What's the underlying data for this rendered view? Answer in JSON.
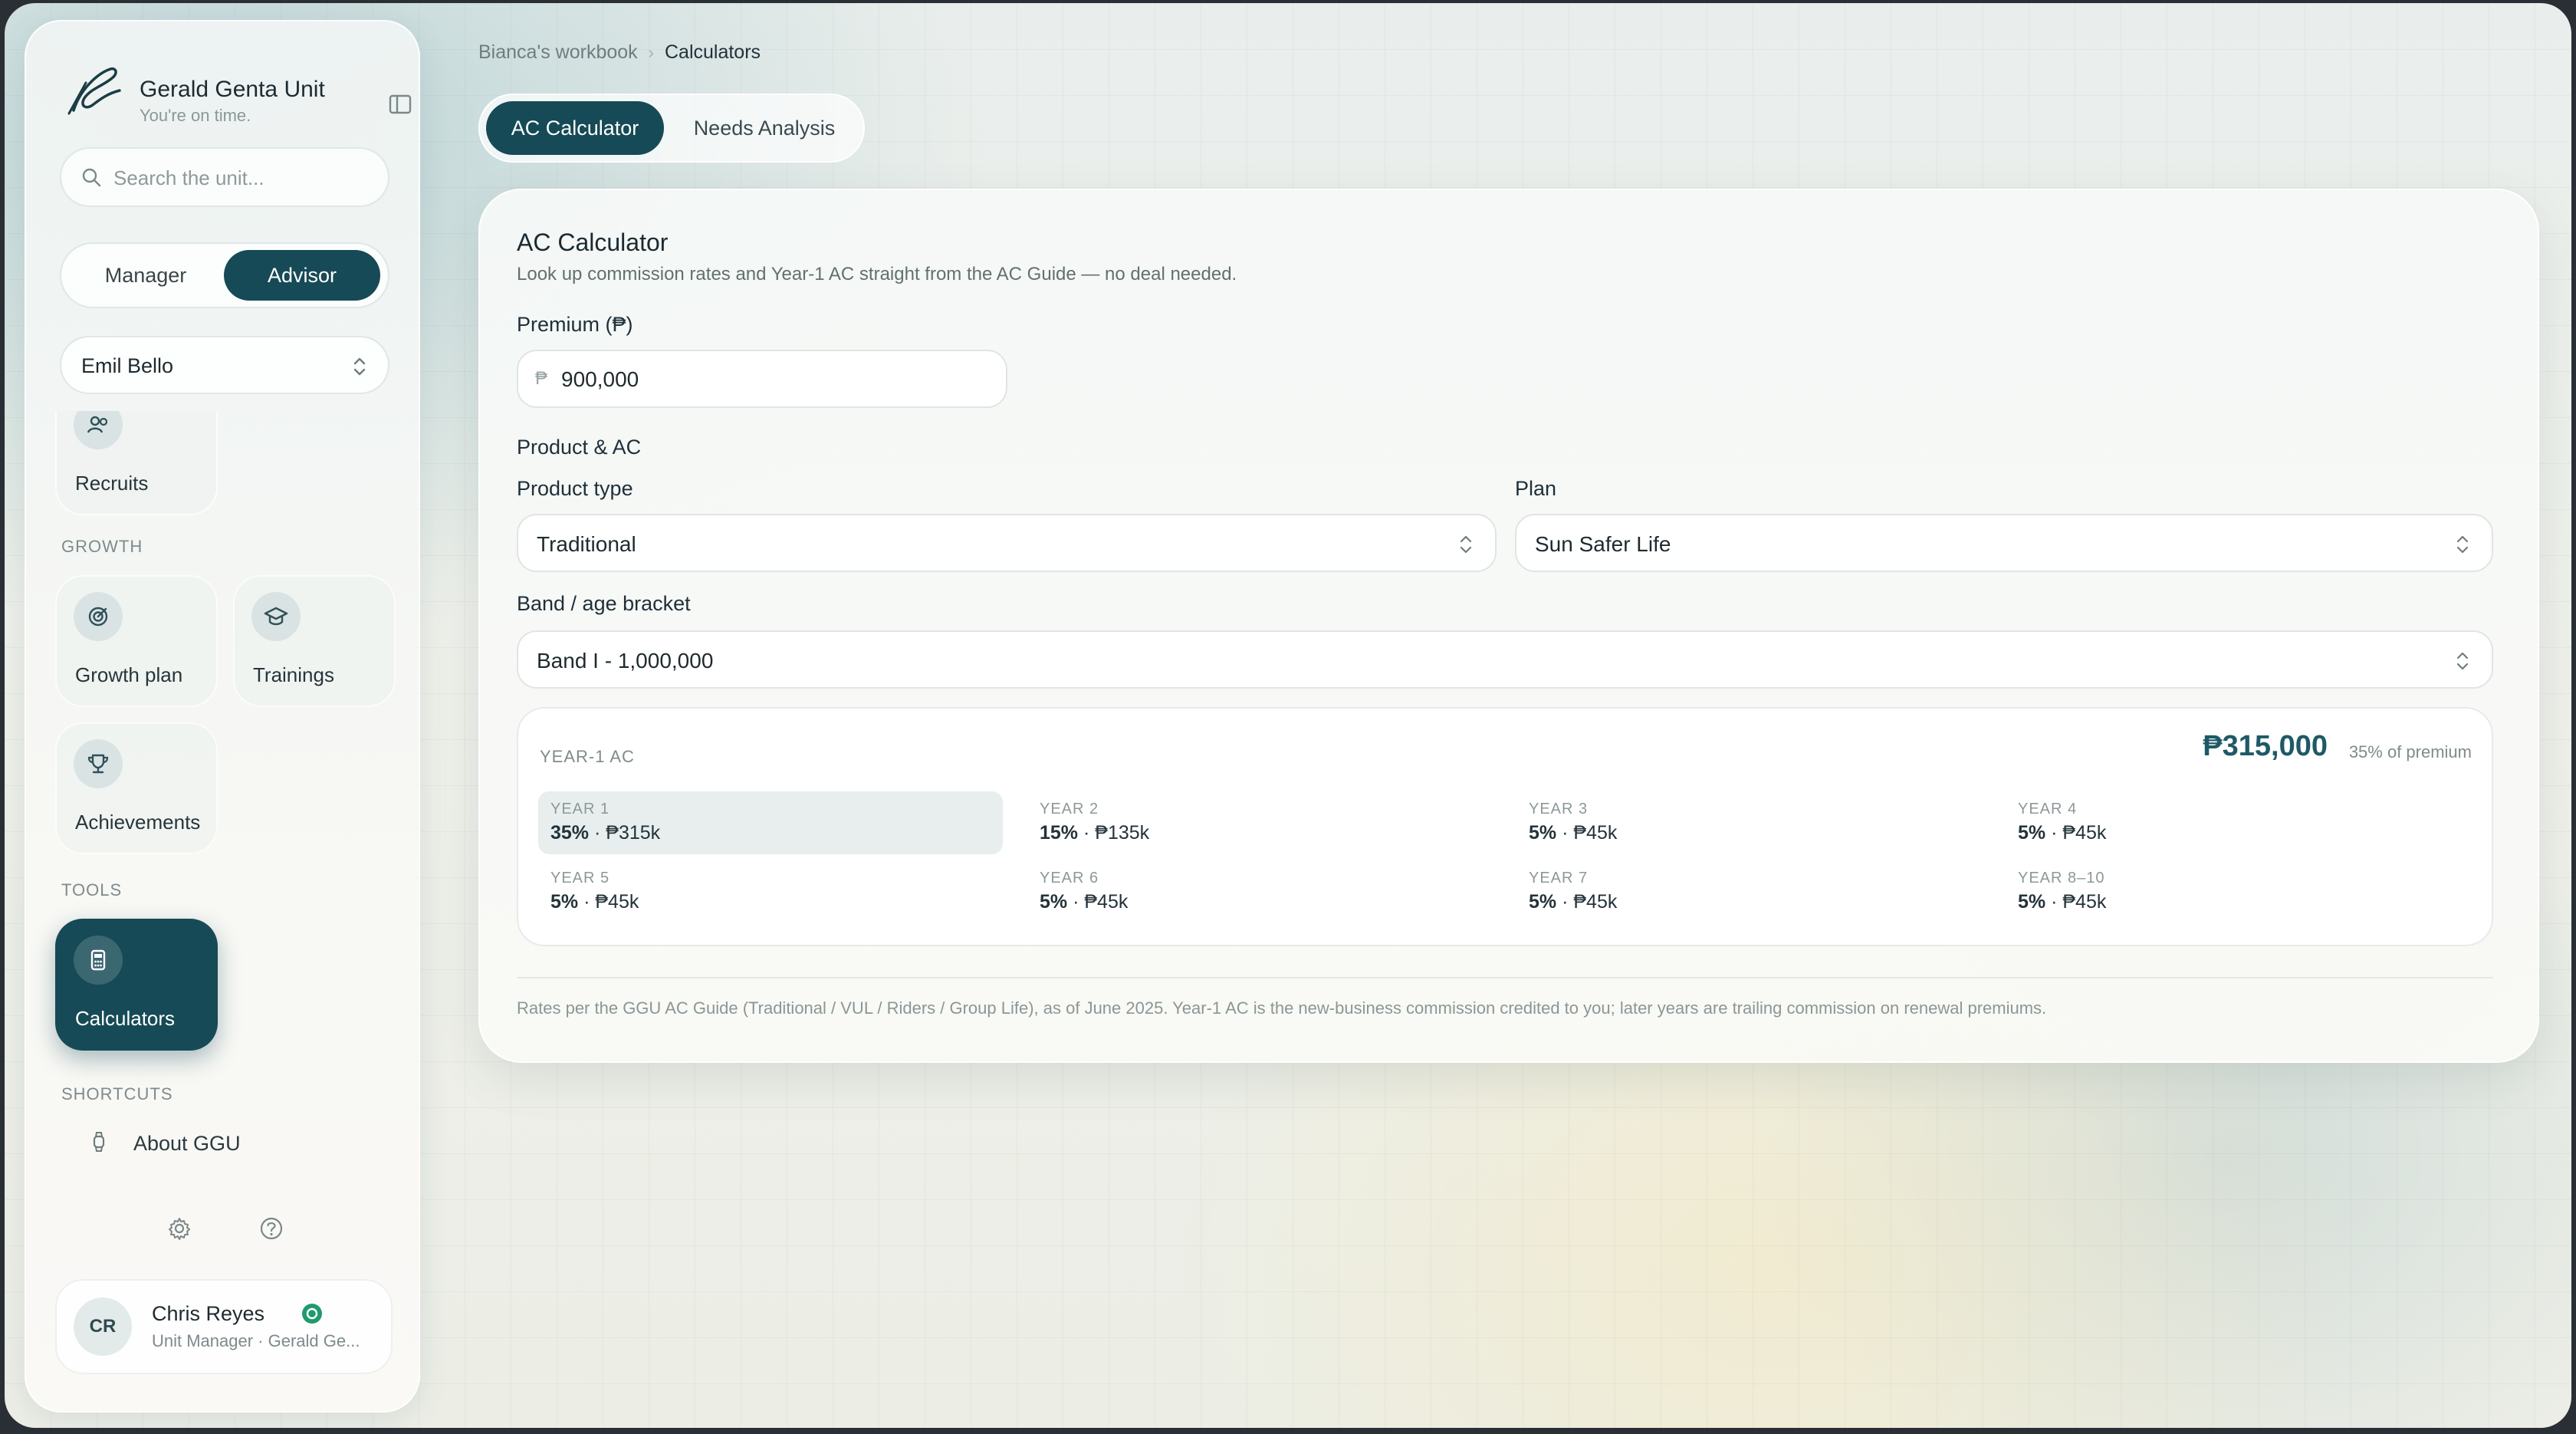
{
  "sidebar": {
    "brand_title": "Gerald Genta Unit",
    "brand_subtitle": "You're on time.",
    "search_placeholder": "Search the unit...",
    "roles": [
      "Manager",
      "Advisor"
    ],
    "active_role": "Advisor",
    "selected_person": "Emil Bello",
    "sections": {
      "growth": "GROWTH",
      "tools": "TOOLS",
      "shortcuts": "SHORTCUTS"
    },
    "tiles": {
      "recruits": "Recruits",
      "growth_plan": "Growth plan",
      "trainings": "Trainings",
      "achievements": "Achievements",
      "calculators": "Calculators"
    },
    "shortcuts": [
      {
        "label": "About GGU",
        "icon": "watch-icon"
      }
    ],
    "user": {
      "initials": "CR",
      "name": "Chris Reyes",
      "role": "Unit Manager · Gerald Ge..."
    }
  },
  "breadcrumb": {
    "parent": "Bianca's workbook",
    "current": "Calculators"
  },
  "tabs": {
    "ac_calculator": "AC Calculator",
    "needs_analysis": "Needs Analysis",
    "active": "AC Calculator"
  },
  "calculator": {
    "title": "AC Calculator",
    "subtitle": "Look up commission rates and Year-1 AC straight from the AC Guide — no deal needed.",
    "premium_label": "Premium (₱)",
    "currency_symbol": "₱",
    "premium_value": "900,000",
    "product_section_label": "Product & AC",
    "product_type_label": "Product type",
    "product_type_value": "Traditional",
    "plan_label": "Plan",
    "plan_value": "Sun Safer Life",
    "band_label": "Band / age bracket",
    "band_value": "Band I - 1,000,000",
    "result": {
      "caption": "YEAR-1 AC",
      "total": "₱315,000",
      "total_note": "35% of premium",
      "years": [
        {
          "label": "YEAR 1",
          "rate": "35%",
          "amount": "₱315k",
          "highlight": true
        },
        {
          "label": "YEAR 2",
          "rate": "15%",
          "amount": "₱135k",
          "highlight": false
        },
        {
          "label": "YEAR 3",
          "rate": "5%",
          "amount": "₱45k",
          "highlight": false
        },
        {
          "label": "YEAR 4",
          "rate": "5%",
          "amount": "₱45k",
          "highlight": false
        },
        {
          "label": "YEAR 5",
          "rate": "5%",
          "amount": "₱45k",
          "highlight": false
        },
        {
          "label": "YEAR 6",
          "rate": "5%",
          "amount": "₱45k",
          "highlight": false
        },
        {
          "label": "YEAR 7",
          "rate": "5%",
          "amount": "₱45k",
          "highlight": false
        },
        {
          "label": "YEAR 8–10",
          "rate": "5%",
          "amount": "₱45k",
          "highlight": false
        }
      ]
    },
    "footnote": "Rates per the GGU AC Guide (Traditional / VUL / Riders / Group Life), as of June 2025. Year-1 AC is the new-business commission credited to you; later years are trailing commission on renewal premiums."
  },
  "colors": {
    "accent": "#164a56",
    "accent_text": "#1e5a66",
    "verified": "#1f9a6e"
  }
}
